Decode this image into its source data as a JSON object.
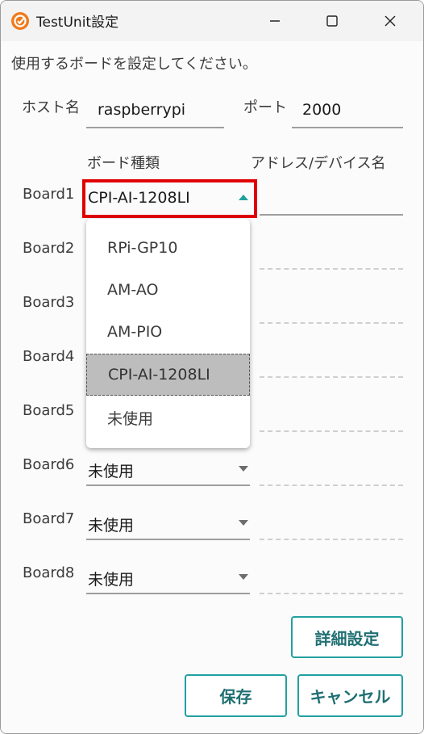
{
  "window": {
    "title": "TestUnit設定"
  },
  "instruction": "使用するボードを設定してください。",
  "host": {
    "label": "ホスト名",
    "value": "raspberrypi"
  },
  "port": {
    "label": "ポート",
    "value": "2000"
  },
  "headers": {
    "board_type": "ボード種類",
    "address": "アドレス/デバイス名"
  },
  "boards": [
    {
      "label": "Board1",
      "value": "CPI-AI-1208LI"
    },
    {
      "label": "Board2",
      "value": ""
    },
    {
      "label": "Board3",
      "value": ""
    },
    {
      "label": "Board4",
      "value": ""
    },
    {
      "label": "Board5",
      "value": ""
    },
    {
      "label": "Board6",
      "value": "未使用"
    },
    {
      "label": "Board7",
      "value": "未使用"
    },
    {
      "label": "Board8",
      "value": "未使用"
    }
  ],
  "dropdown_options": [
    "RPi-GP10",
    "AM-AO",
    "AM-PIO",
    "CPI-AI-1208LI",
    "未使用"
  ],
  "dropdown_selected": "CPI-AI-1208LI",
  "buttons": {
    "details": "詳細設定",
    "save": "保存",
    "cancel": "キャンセル"
  },
  "colors": {
    "accent": "#22a0a0",
    "highlight": "#e00000",
    "app_icon": "#f07a1c"
  }
}
